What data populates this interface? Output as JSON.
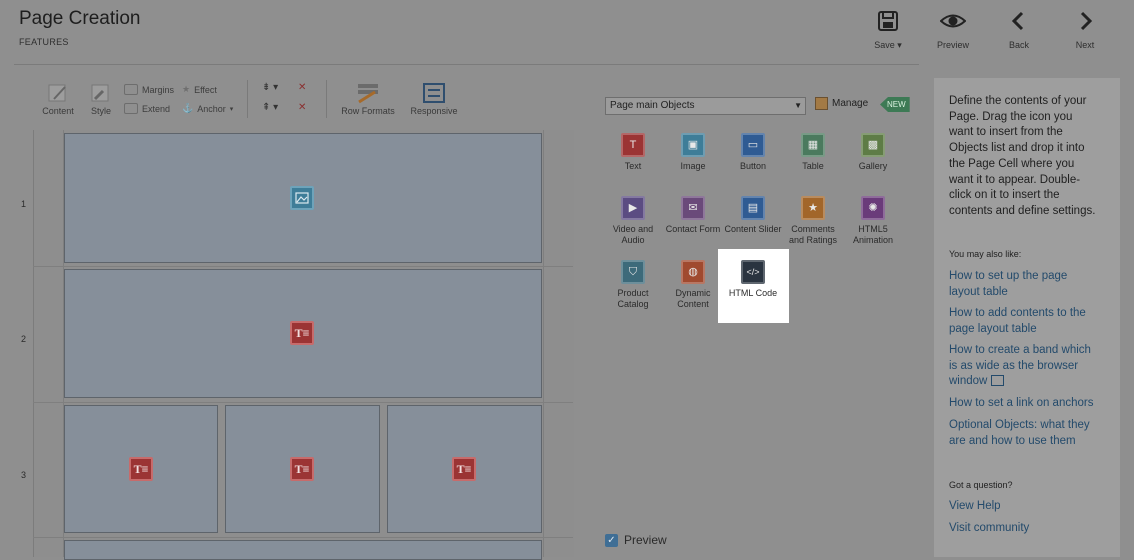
{
  "header": {
    "title": "Page Creation",
    "subtitle": "FEATURES",
    "buttons": {
      "save": "Save ▾",
      "preview": "Preview",
      "back": "Back",
      "next": "Next"
    }
  },
  "toolbar": {
    "content": "Content",
    "style": "Style",
    "margins": "Margins",
    "effect": "Effect",
    "extend": "Extend",
    "anchor": "Anchor",
    "row_formats": "Row Formats",
    "responsive": "Responsive"
  },
  "grid": {
    "rows": [
      "1",
      "2",
      "3"
    ]
  },
  "objects_panel": {
    "dropdown_value": "Page main Objects",
    "manage_label": "Manage",
    "new_badge": "NEW",
    "items": [
      {
        "label": "Text",
        "icon": "text-icon",
        "color": "#9b3434"
      },
      {
        "label": "Image",
        "icon": "image-icon",
        "color": "#3e7d98"
      },
      {
        "label": "Button",
        "icon": "button-icon",
        "color": "#2f5b93"
      },
      {
        "label": "Table",
        "icon": "table-icon",
        "color": "#4b7a5e"
      },
      {
        "label": "Gallery",
        "icon": "gallery-icon",
        "color": "#5e7c46"
      },
      {
        "label": "Video and Audio",
        "icon": "video-audio-icon",
        "color": "#5b4c82"
      },
      {
        "label": "Contact Form",
        "icon": "contact-form-icon",
        "color": "#6a4a7a"
      },
      {
        "label": "Content Slider",
        "icon": "content-slider-icon",
        "color": "#2f5b93"
      },
      {
        "label": "Comments and Ratings",
        "icon": "comments-ratings-icon",
        "color": "#a2662a"
      },
      {
        "label": "HTML5 Animation",
        "icon": "html5-animation-icon",
        "color": "#6a3b7a"
      },
      {
        "label": "Product Catalog",
        "icon": "product-catalog-icon",
        "color": "#3d6a7a"
      },
      {
        "label": "Dynamic Content",
        "icon": "dynamic-content-icon",
        "color": "#a04a2f"
      },
      {
        "label": "HTML Code",
        "icon": "html-code-icon",
        "color": "#2a3440"
      }
    ],
    "preview_label": "Preview"
  },
  "help": {
    "intro": "Define the contents of your Page. Drag the icon you want to insert from the Objects list and drop it into the Page Cell where you want it to appear. Double-click on it to insert the contents and define settings.",
    "also_like": "You may also like:",
    "links": [
      "How to set up the page layout table",
      "How to add contents to the page layout table",
      "How to create a band which is as wide as the browser window",
      "How to set a link on anchors",
      "Optional Objects: what they are and how to use them"
    ],
    "question": "Got a question?",
    "view_help": "View Help",
    "visit_community": "Visit community"
  }
}
